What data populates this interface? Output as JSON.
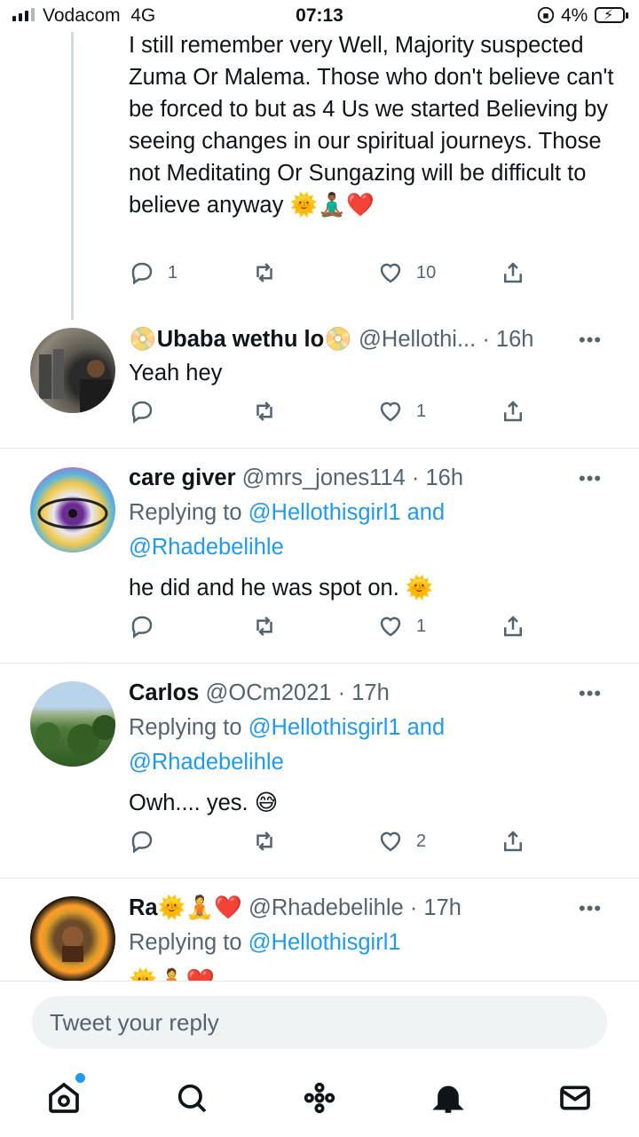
{
  "status_bar": {
    "carrier": "Vodacom",
    "network": "4G",
    "time": "07:13",
    "battery": "4%"
  },
  "top_tweet": {
    "text": "I still remember very Well, Majority suspected Zuma Or Malema. Those who don't believe can't be forced to but as 4 Us we started Believing by seeing changes in our spiritual journeys. Those not Meditating Or Sungazing will be difficult to believe anyway 🌞🧘🏾‍♂️❤️",
    "replies": "1",
    "retweets": "",
    "likes": "10"
  },
  "replies": [
    {
      "display_name": "📀Ubaba wethu lo📀",
      "handle": "@Hellothi...",
      "time": "· 16h",
      "replying_prefix": "",
      "replying_mentions": "",
      "text": "Yeah hey",
      "reply_count": "",
      "retweet_count": "",
      "like_count": "1"
    },
    {
      "display_name": "care giver",
      "handle": "@mrs_jones114",
      "time": "· 16h",
      "replying_prefix": "Replying to",
      "replying_mentions": "@Hellothisgirl1 and @Rhadebelihle",
      "text": "he did and he was spot on. 🌞",
      "reply_count": "",
      "retweet_count": "",
      "like_count": "1"
    },
    {
      "display_name": "Carlos",
      "handle": "@OCm2021",
      "time": "· 17h",
      "replying_prefix": "Replying to",
      "replying_mentions": "@Hellothisgirl1 and @Rhadebelihle",
      "text": "Owh.... yes. 😅",
      "reply_count": "",
      "retweet_count": "",
      "like_count": "2"
    },
    {
      "display_name": "Ra🌞🧘❤️",
      "handle": "@Rhadebelihle",
      "time": "· 17h",
      "replying_prefix": "Replying to",
      "replying_mentions": "@Hellothisgirl1",
      "text": "🌞🧘❤️"
    }
  ],
  "more_label": "•••",
  "composer": {
    "placeholder": "Tweet your reply"
  },
  "tabbar": [
    "home-icon",
    "search-icon",
    "spaces-icon",
    "notifications-icon",
    "messages-icon"
  ],
  "colors": {
    "accent": "#1d9bf0",
    "text": "#0f1419",
    "muted": "#536471"
  }
}
